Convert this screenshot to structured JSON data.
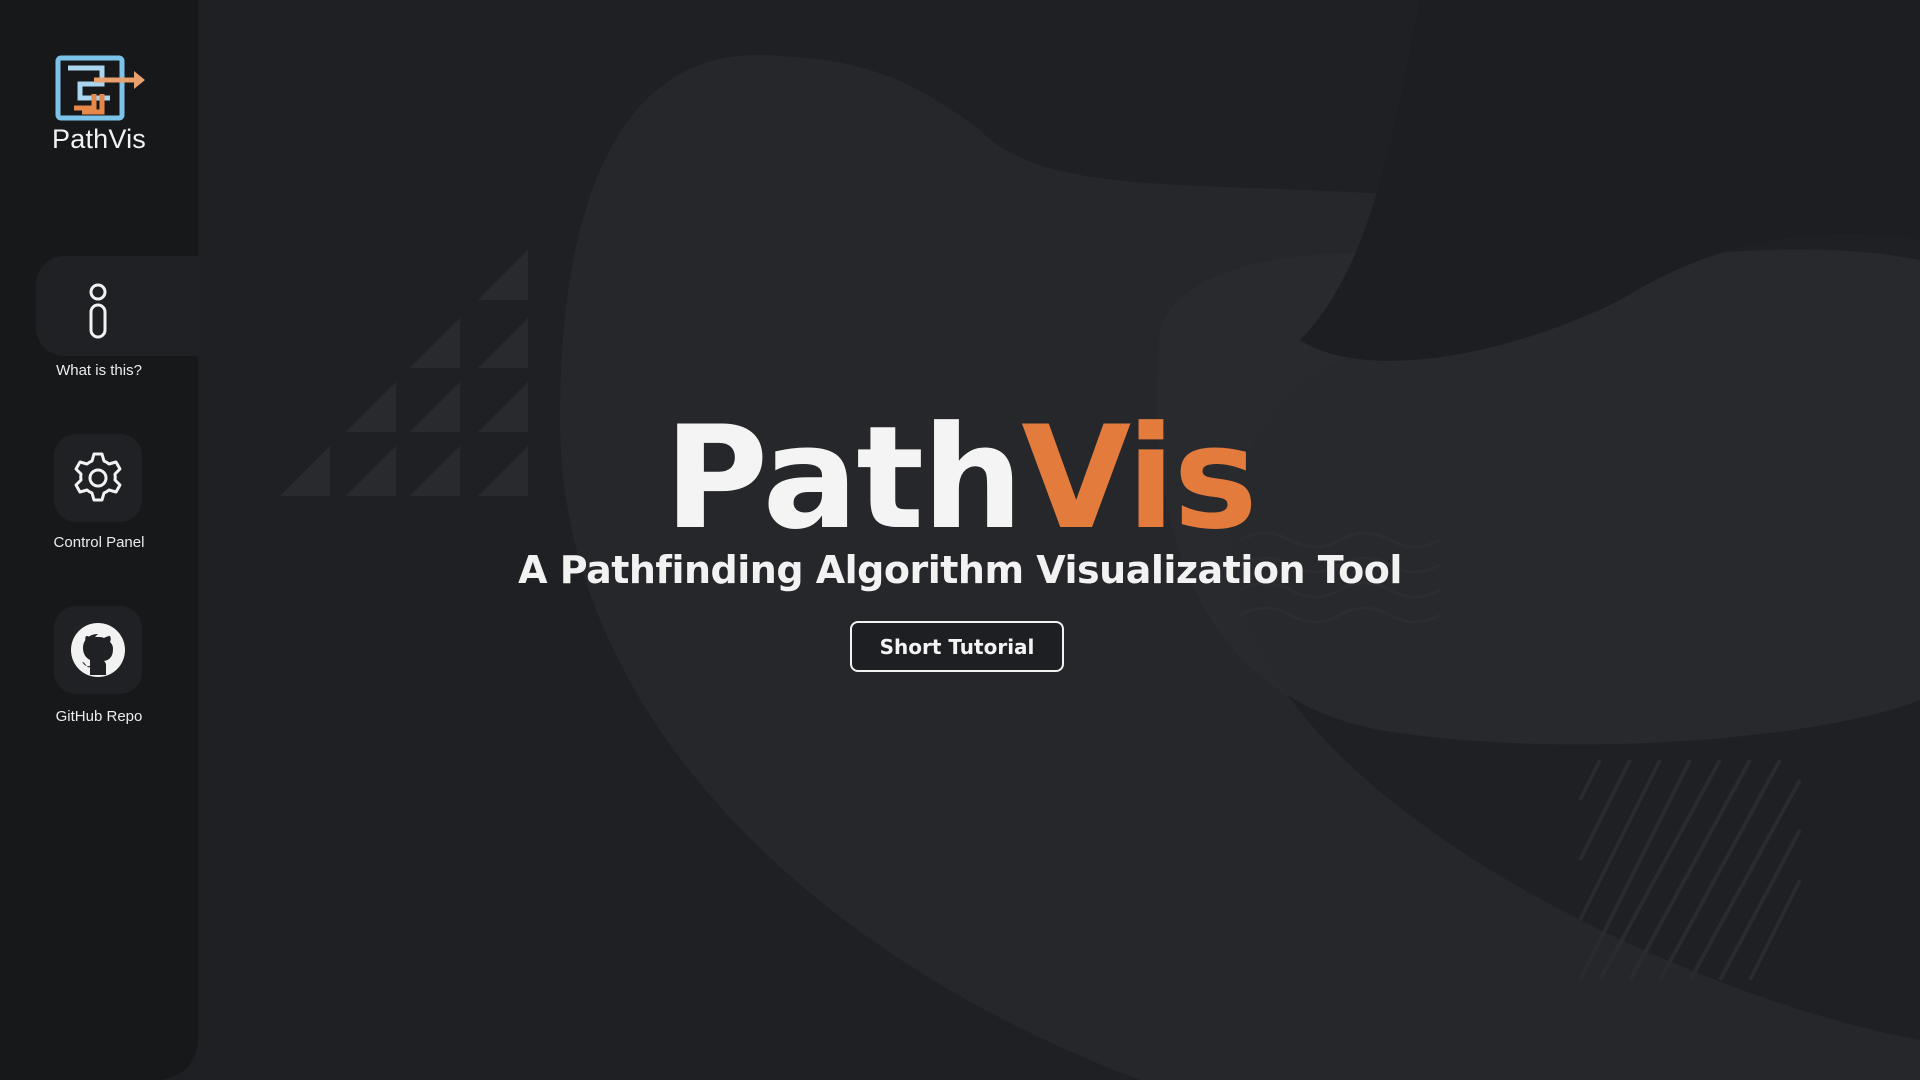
{
  "app": {
    "name": "PathVis"
  },
  "sidebar": {
    "logo_text": "PathVis",
    "items": [
      {
        "label": "What is this?",
        "icon": "info-icon",
        "active": true
      },
      {
        "label": "Control Panel",
        "icon": "gear-icon",
        "active": false
      },
      {
        "label": "GitHub Repo",
        "icon": "github-icon",
        "active": false
      }
    ]
  },
  "hero": {
    "title_part_a": "Path",
    "title_part_b": "Vis",
    "subtitle": "A Pathfinding Algorithm Visualization Tool",
    "button_label": "Short Tutorial"
  },
  "colors": {
    "background": "#1f2023",
    "sidebar": "#17181a",
    "accent": "#e27b3c",
    "text": "#f2f2f2"
  }
}
